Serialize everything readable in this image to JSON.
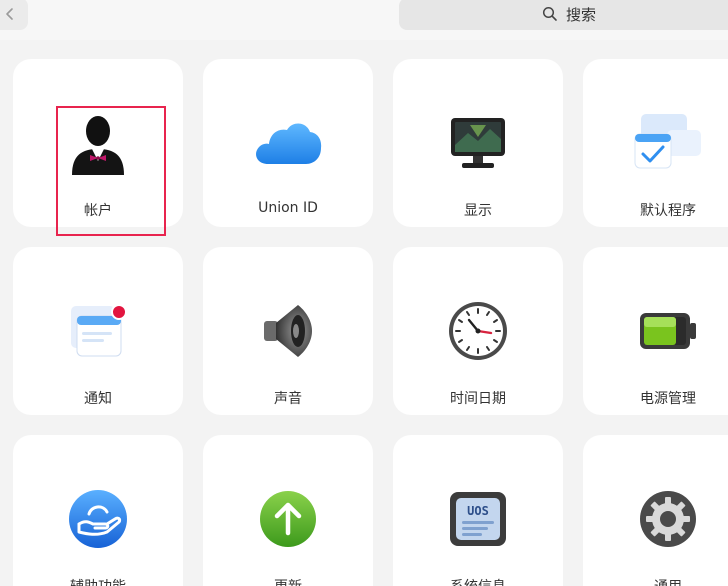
{
  "header": {
    "search_label": "搜索"
  },
  "tiles": [
    {
      "label": "帐户",
      "icon": "user-account-icon"
    },
    {
      "label": "Union ID",
      "icon": "cloud-icon"
    },
    {
      "label": "显示",
      "icon": "monitor-icon"
    },
    {
      "label": "默认程序",
      "icon": "default-apps-icon"
    },
    {
      "label": "通知",
      "icon": "notification-icon"
    },
    {
      "label": "声音",
      "icon": "speaker-icon"
    },
    {
      "label": "时间日期",
      "icon": "clock-icon"
    },
    {
      "label": "电源管理",
      "icon": "battery-icon"
    },
    {
      "label": "辅助功能",
      "icon": "accessibility-hand-icon"
    },
    {
      "label": "更新",
      "icon": "update-arrow-icon"
    },
    {
      "label": "系统信息",
      "icon": "system-info-chip-icon"
    },
    {
      "label": "通用",
      "icon": "gear-icon"
    }
  ],
  "system_chip_text": "UOS",
  "colors": {
    "background": "#f3f3f3",
    "tile": "#ffffff",
    "selection": "#e8244e",
    "cloud": "#2f8ff0",
    "update_green": "#5ab52c",
    "accessibility_blue": "#1f73e0",
    "battery_green": "#76c51c"
  }
}
